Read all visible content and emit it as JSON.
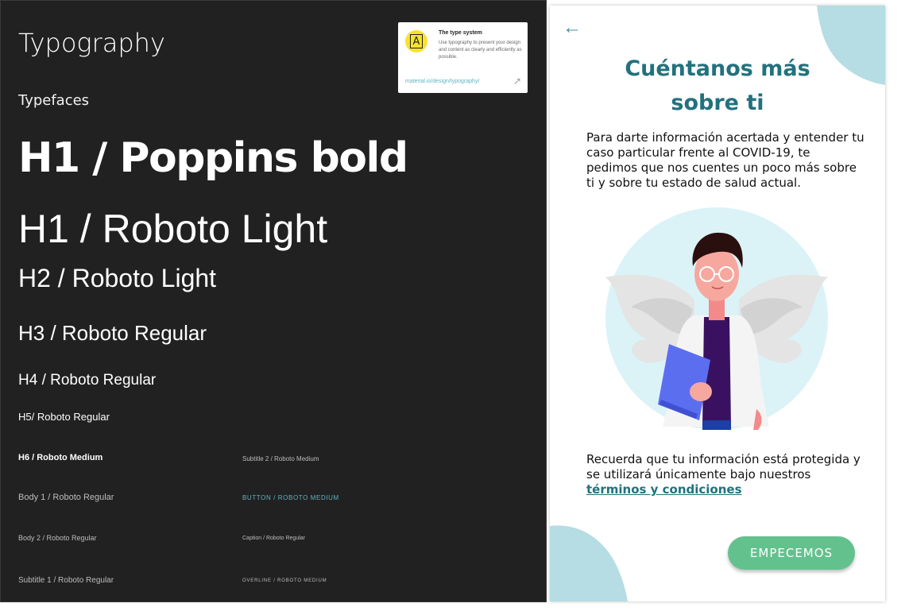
{
  "typography": {
    "title": "Typography",
    "section": "Typefaces",
    "samples": {
      "h1_poppins": "H1 / Poppins bold",
      "h1_roboto": "H1 / Roboto Light",
      "h2": "H2 / Roboto Light",
      "h3": "H3 / Roboto Regular",
      "h4": "H4 / Roboto Regular",
      "h5": "H5/ Roboto Regular",
      "h6": "H6 / Roboto Medium",
      "body1": "Body 1 / Roboto Regular",
      "body2": "Body 2 / Roboto Regular",
      "subtitle1": "Subtitle 1 / Roboto Regular",
      "subtitle2": "Subtitle 2 / Roboto Medium",
      "button": "BUTTON / ROBOTO MEDIUM",
      "caption": "Caption / Roboto Regular",
      "overline": "OVERLINE / ROBOTO MEDIUM"
    },
    "card": {
      "badge": "A",
      "title": "The type system",
      "description": "Use typography to present your design and content as clearly and efficiently as possible.",
      "link": "material.io/design/typography/"
    }
  },
  "screen": {
    "title_line1": "Cuéntanos más",
    "title_line2": "sobre ti",
    "intro": "Para darte información acertada y entender tu caso particular frente al COVID-19,  te pedimos que nos cuentes un poco más sobre ti y sobre tu estado de salud actual.",
    "privacy": "Recuerda que tu información está protegida y se utilizará únicamente bajo nuestros",
    "terms_link": "términos y condiciones",
    "button": "EMPECEMOS"
  },
  "icons": {
    "back": "arrow-left-icon",
    "card_open": "arrow-up-right-icon"
  },
  "colors": {
    "dark_panel": "#212121",
    "title_teal": "#22717e",
    "accent_blob": "#b5dde3",
    "button_green": "#63c18e",
    "link_blue": "#5fb3c4"
  }
}
